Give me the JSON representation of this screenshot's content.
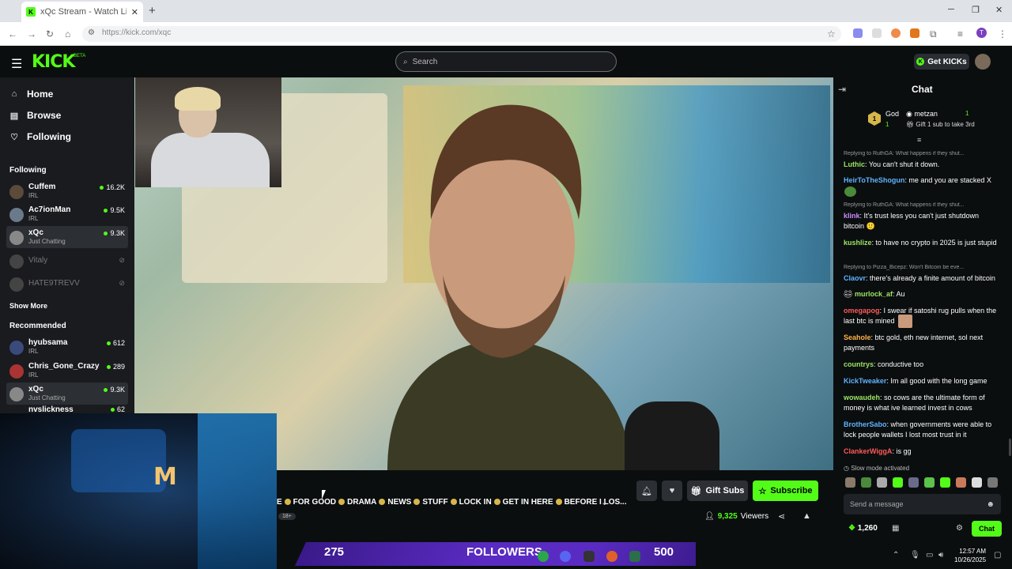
{
  "browser": {
    "tab_title": "xQc Stream - Watch Live o",
    "tab_close": "✕",
    "new_tab": "+",
    "url": "https://kick.com/xqc",
    "window_min": "─",
    "window_max": "❐",
    "window_close": "✕",
    "profile_initial": "T"
  },
  "header": {
    "logo": "KICK",
    "logo_badge": "BETA",
    "search_placeholder": "Search",
    "get_kicks_label": "Get KICKs"
  },
  "sidebar": {
    "nav": [
      {
        "label": "Home",
        "icon": "home-icon"
      },
      {
        "label": "Browse",
        "icon": "browse-icon"
      },
      {
        "label": "Following",
        "icon": "heart-icon"
      }
    ],
    "following_heading": "Following",
    "following": [
      {
        "name": "Cuffem",
        "category": "IRL",
        "viewers": "16.2K"
      },
      {
        "name": "Ac7ionMan",
        "category": "IRL",
        "viewers": "9.5K"
      },
      {
        "name": "xQc",
        "category": "Just Chatting",
        "viewers": "9.3K",
        "active": true
      },
      {
        "name": "Vitaly",
        "offline": true
      },
      {
        "name": "HATE9TREVV",
        "offline": true
      }
    ],
    "show_more": "Show More",
    "recommended_heading": "Recommended",
    "recommended": [
      {
        "name": "hyubsama",
        "category": "IRL",
        "viewers": "612"
      },
      {
        "name": "Chris_Gone_Crazy",
        "category": "IRL",
        "viewers": "289"
      },
      {
        "name": "xQc",
        "category": "Just Chatting",
        "viewers": "9.3K",
        "active": true
      },
      {
        "name": "nvslickness",
        "viewers": "62"
      }
    ]
  },
  "player": {
    "cam_overlay_letter": "M",
    "stream_title": "E 🟡 FOR GOOD 🟡 DRAMA 🟡 NEWS 🟡 STUFF 🟡 LOCK IN 🟡 GET IN HERE 🟡 BEFORE I LOS...",
    "title_segments": [
      "E",
      "FOR GOOD",
      "DRAMA",
      "NEWS",
      "STUFF",
      "LOCK IN",
      "GET IN HERE",
      "BEFORE I LOS..."
    ],
    "age_badge": "18+",
    "gift_subs_label": "Gift Subs",
    "subscribe_label": "Subscribe",
    "viewer_count": "9,325",
    "viewers_label": "Viewers"
  },
  "follower_bar": {
    "current": "275",
    "label": "FOLLOWERS",
    "goal": "500"
  },
  "taskbar": {
    "time": "12:57 AM",
    "date": "10/26/2025"
  },
  "chat": {
    "title": "Chat",
    "pinned": {
      "badge_rank": "1",
      "badge_label": "God",
      "badge_count": "1",
      "username": "metzan",
      "sub_count": "1",
      "gift_text": "Gift 1 sub to take 3rd"
    },
    "messages": [
      {
        "reply": "Replying to RuthGA: What happens if they shut...",
        "user": "Luthic",
        "color": "#9be564",
        "text": "You can't shut it down."
      },
      {
        "user": "HeirToTheShogun",
        "color": "#5fb3ff",
        "text": "me and you are stacked X"
      },
      {
        "reply": "Replying to RuthGA: What happens if they shut...",
        "user": "klink",
        "color": "#c98cff",
        "text": "It's trust less you can't just shutdown bitcoin 🙂"
      },
      {
        "user": "kushlize",
        "color": "#9be564",
        "text": "to have no crypto in 2025 is just stupid"
      },
      {
        "reply": "Replying to Pizza_Bicepz: Won't Bitcoin be eve...",
        "user": "Claovr",
        "color": "#5fb3ff",
        "text": "there's already a finite amount of bitcoin"
      },
      {
        "user": "murlock_af",
        "color": "#9be564",
        "text": "Au"
      },
      {
        "user": "omegapog",
        "color": "#ff5a5a",
        "text": "I swear if satoshi rug pulls when the last btc is mined"
      },
      {
        "user": "Seahole",
        "color": "#ffb347",
        "text": "btc gold, eth new internet, sol next payments"
      },
      {
        "user": "countrys",
        "color": "#9be564",
        "text": "conductive too"
      },
      {
        "user": "KickTweaker",
        "color": "#5fb3ff",
        "text": "Im all good with the long game"
      },
      {
        "user": "wowaudeh",
        "color": "#9be564",
        "text": "so cows are the ultimate form of money is what ive learned invest in cows"
      },
      {
        "user": "BrotherSabo",
        "color": "#5fb3ff",
        "text": "when governments were able to lock people wallets I lost most trust in it"
      },
      {
        "user": "ClankerWiggA",
        "color": "#ff5a5a",
        "text": "is gg"
      }
    ],
    "slow_mode": "Slow mode activated",
    "input_placeholder": "Send a message",
    "kicks_balance": "1,260",
    "chat_button": "Chat"
  },
  "colors": {
    "kick_green": "#53fc18",
    "sidebar_bg": "#191b1f",
    "page_bg": "#0b0e0f",
    "follower_bar": "#5a2bc2"
  }
}
